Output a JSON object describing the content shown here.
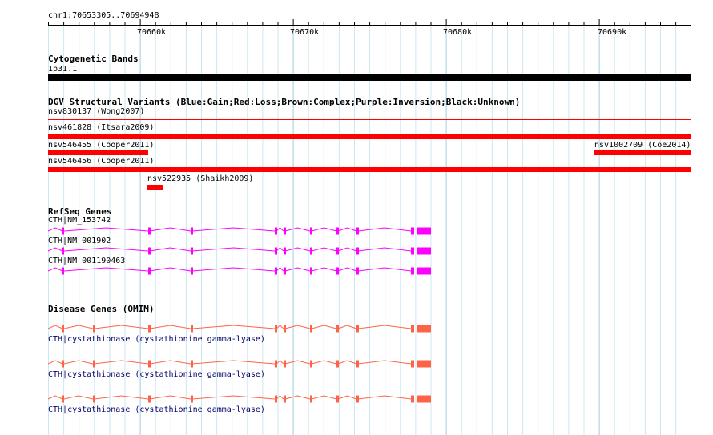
{
  "ruler": {
    "range_label": "chr1:70653305..70694948",
    "ticks": [
      "70660k",
      "70670k",
      "70680k",
      "70690k"
    ]
  },
  "cytobands": {
    "title": "Cytogenetic Bands",
    "band_label": "1p31.1",
    "band_color": "#000000"
  },
  "dgv": {
    "title": "DGV Structural Variants (Blue:Gain;Red:Loss;Brown:Complex;Purple:Inversion;Black:Unknown)",
    "loss_color": "#ff0000",
    "variants": [
      {
        "name": "nsv830137 (Wong2007)"
      },
      {
        "name": "nsv461828 (Itsara2009)"
      },
      {
        "name": "nsv546455 (Cooper2011)"
      },
      {
        "name": "nsv1002709 (Coe2014)"
      },
      {
        "name": "nsv546456 (Cooper2011)"
      },
      {
        "name": "nsv522935 (Shaikh2009)"
      }
    ]
  },
  "refseq": {
    "title": "RefSeq Genes",
    "color": "#ff00ff",
    "genes": [
      {
        "name": "CTH|NM_153742"
      },
      {
        "name": "CTH|NM_001902"
      },
      {
        "name": "CTH|NM_001190463"
      }
    ]
  },
  "omim": {
    "title": "Disease Genes (OMIM)",
    "color": "#ff6347",
    "genes": [
      {
        "name": "CTH|cystathionase (cystathionine gamma-lyase)"
      },
      {
        "name": "CTH|cystathionase (cystathionine gamma-lyase)"
      },
      {
        "name": "CTH|cystathionase (cystathionine gamma-lyase)"
      }
    ]
  }
}
